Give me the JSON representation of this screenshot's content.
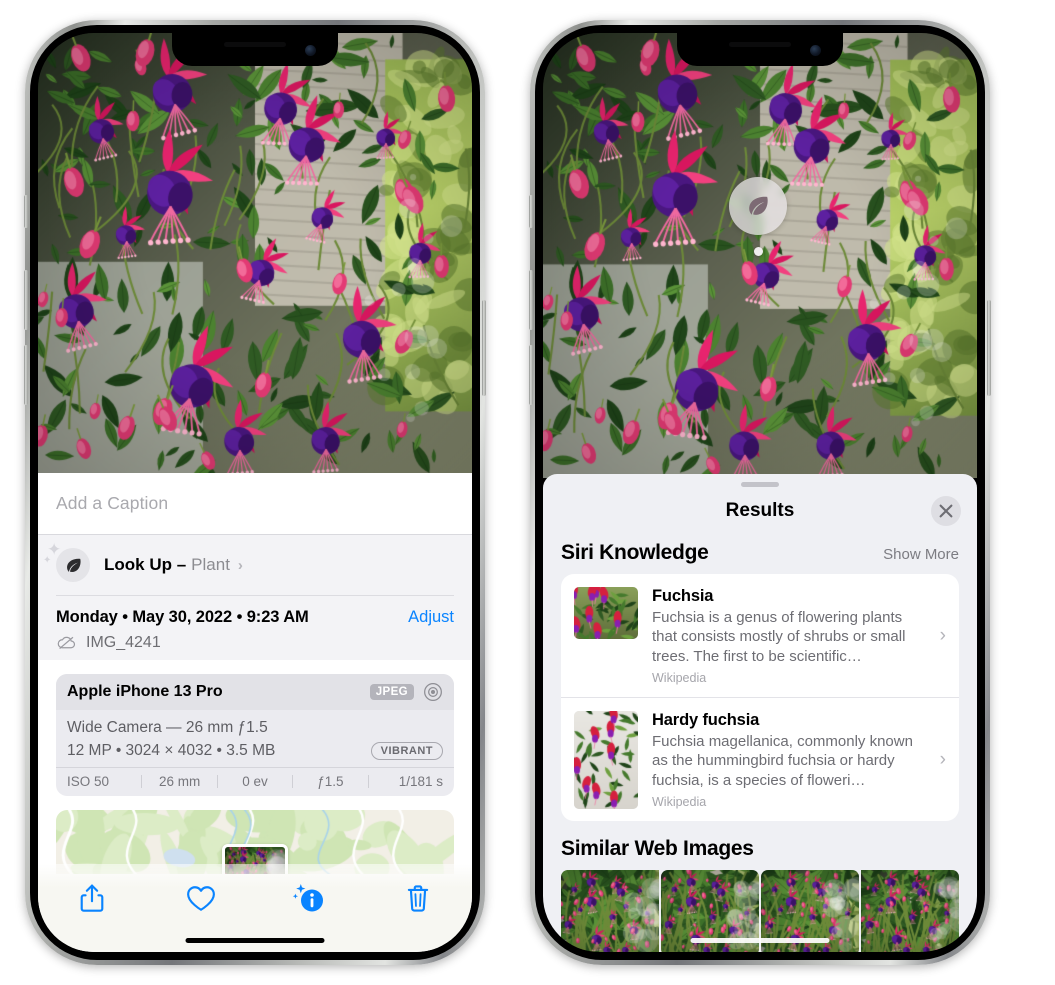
{
  "left_phone": {
    "caption": {
      "placeholder": "Add a Caption",
      "value": ""
    },
    "lookup": {
      "label": "Look Up –",
      "subject": "Plant",
      "chevron": "›",
      "icon": "leaf-icon"
    },
    "meta": {
      "date": "Monday • May 30, 2022 • 9:23 AM",
      "adjust_label": "Adjust",
      "filename": "IMG_4241",
      "cloud_icon": "icloud-slash-icon"
    },
    "camera_card": {
      "device": "Apple iPhone 13 Pro",
      "format_tag": "JPEG",
      "aperture_icon": "aperture-icon",
      "lens_line": "Wide Camera — 26 mm ƒ1.5",
      "spec_line": "12 MP • 3024 × 4032 • 3.5 MB",
      "style_tag": "VIBRANT",
      "exif": [
        "ISO 50",
        "26 mm",
        "0 ev",
        "ƒ1.5",
        "1/181 s"
      ]
    },
    "toolbar": [
      {
        "name": "share-button",
        "icon": "share-icon"
      },
      {
        "name": "favorite-button",
        "icon": "heart-icon"
      },
      {
        "name": "info-button",
        "icon": "info-sparkle-icon"
      },
      {
        "name": "delete-button",
        "icon": "trash-icon"
      }
    ]
  },
  "right_phone": {
    "pin": {
      "icon": "leaf-icon"
    },
    "sheet": {
      "title": "Results",
      "close_icon": "close-icon",
      "siri_section": {
        "heading": "Siri Knowledge",
        "show_more": "Show More"
      },
      "knowledge_cards": [
        {
          "title": "Fuchsia",
          "description": "Fuchsia is a genus of flowering plants that consists mostly of shrubs or small trees. The first to be scientific…",
          "source": "Wikipedia",
          "chevron": "›"
        },
        {
          "title": "Hardy fuchsia",
          "description": "Fuchsia magellanica, commonly known as the hummingbird fuchsia or hardy fuchsia, is a species of floweri…",
          "source": "Wikipedia",
          "chevron": "›"
        }
      ],
      "similar_section": {
        "heading": "Similar Web Images",
        "thumbnail_count": 4
      }
    }
  },
  "colors": {
    "accent_blue": "#0a84ff",
    "sheet_bg": "#eff0f4",
    "card_bg": "#ffffff",
    "secondary_text": "#6d6d73",
    "tertiary_text": "#a5a5ab"
  }
}
